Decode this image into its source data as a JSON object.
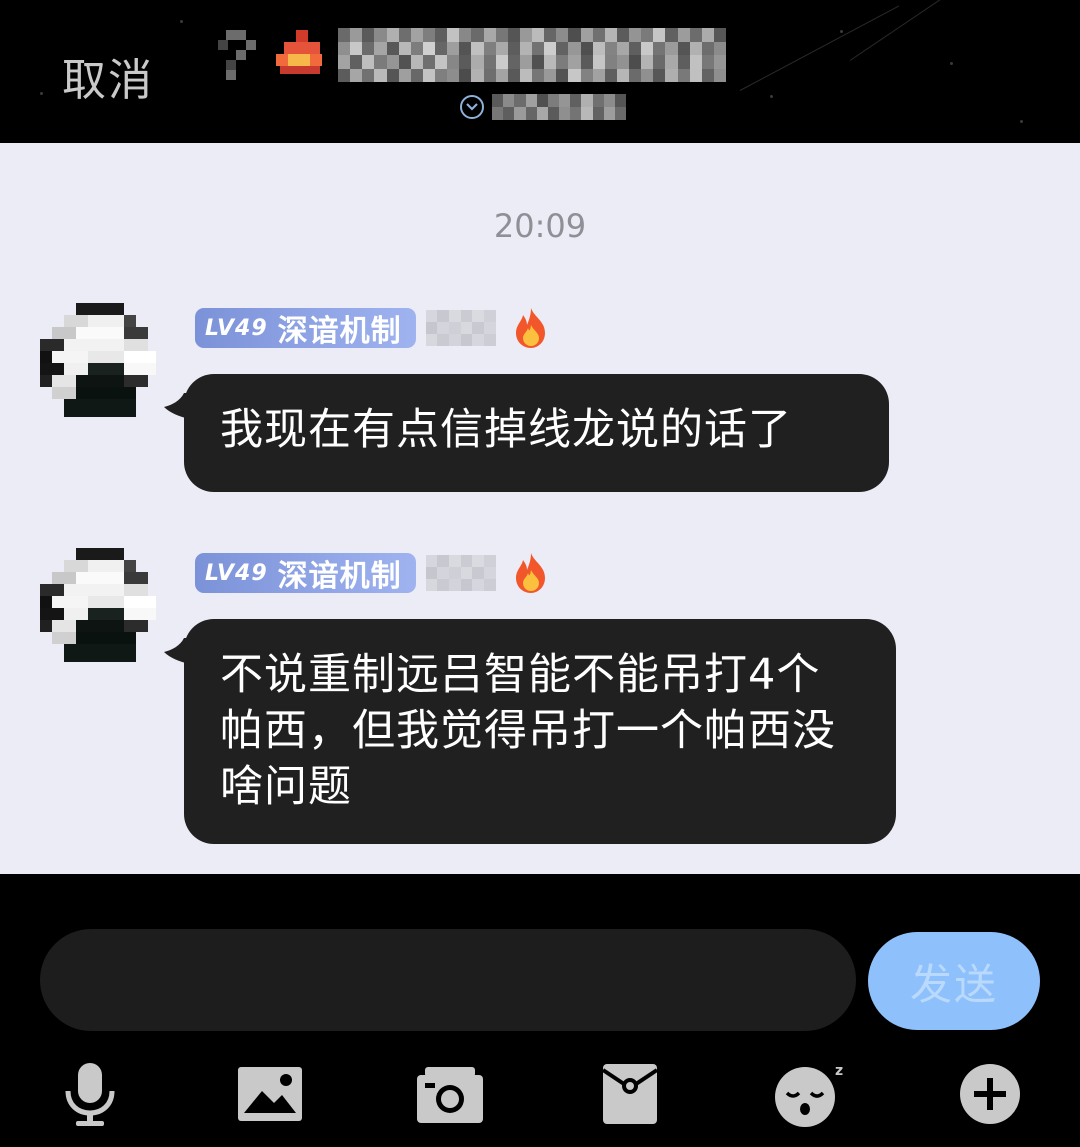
{
  "header": {
    "cancel_label": "取消",
    "title": "",
    "subtitle": ""
  },
  "chat": {
    "timestamp": "20:09",
    "messages": [
      {
        "level": "LV49",
        "badge_title": "深谙机制",
        "text": "我现在有点信掉线龙说的话了"
      },
      {
        "level": "LV49",
        "badge_title": "深谙机制",
        "text": "不说重制远吕智能不能吊打4个帕西，但我觉得吊打一个帕西没啥问题"
      }
    ]
  },
  "input": {
    "placeholder": "",
    "value": "",
    "send_label": "发送"
  },
  "toolbar": {
    "items": [
      "microphone-icon",
      "image-icon",
      "camera-icon",
      "red-packet-icon",
      "sleepy-emoji-icon",
      "plus-icon"
    ]
  },
  "colors": {
    "chat_background": "#ececf6",
    "bubble": "#202020",
    "send_button": "#8ec0fb",
    "badge_start": "#7c92d8",
    "badge_end": "#9fb3f0"
  }
}
